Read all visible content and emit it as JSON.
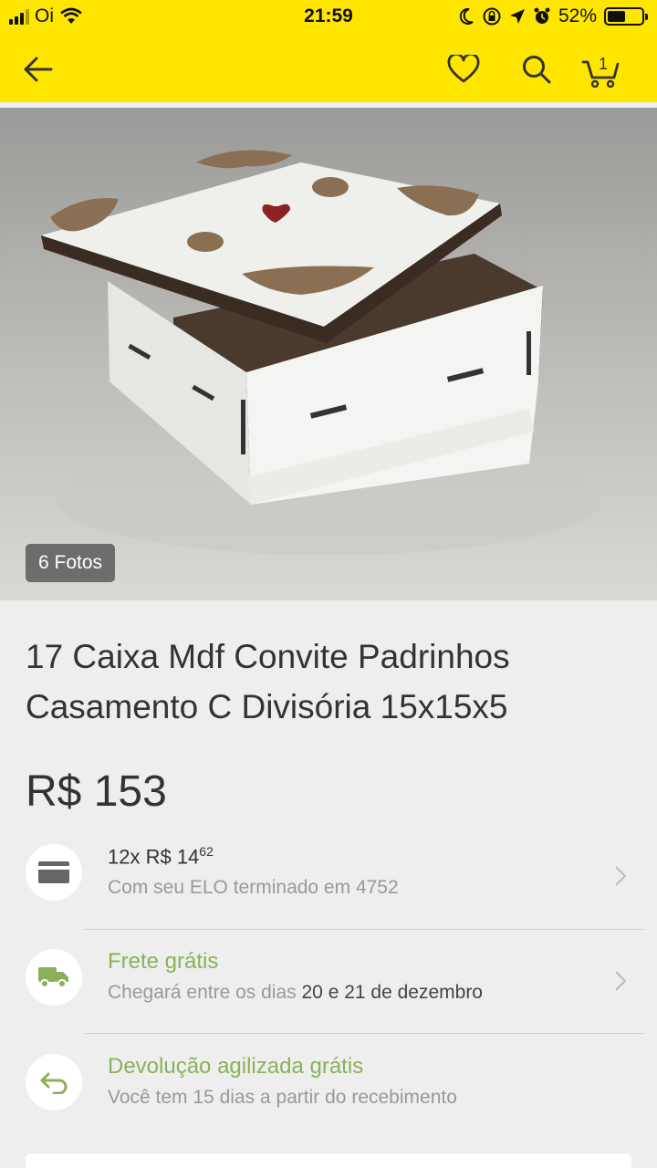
{
  "status": {
    "carrier": "Oi",
    "time": "21:59",
    "battery": "52%",
    "battery_level": 0.52
  },
  "header": {
    "back_icon": "arrow-left-icon",
    "favorite_icon": "heart-icon",
    "search_icon": "search-icon",
    "cart_icon": "cart-icon",
    "cart_count": "1",
    "background": "#ffe600"
  },
  "product": {
    "photo_count_label": "6 Fotos",
    "title": "17 Caixa Mdf Convite Padrinhos Casamento C Divisória 15x15x5",
    "price": "R$ 153"
  },
  "installments": {
    "icon": "credit-card-icon",
    "prefix": "12x R$ 14",
    "cents": "62",
    "detail": "Com seu ELO terminado em 4752"
  },
  "shipping": {
    "icon": "truck-icon",
    "label": "Frete grátis",
    "detail_prefix": "Chegará entre os dias",
    "day_start": "20",
    "and": "e",
    "day_end": "21 de dezembro"
  },
  "returns": {
    "icon": "return-arrow-icon",
    "label": "Devolução agilizada grátis",
    "detail": "Você tem 15 dias a partir do recebimento"
  },
  "colors": {
    "accent_green": "#8ab15a",
    "brand_yellow": "#ffe600"
  }
}
